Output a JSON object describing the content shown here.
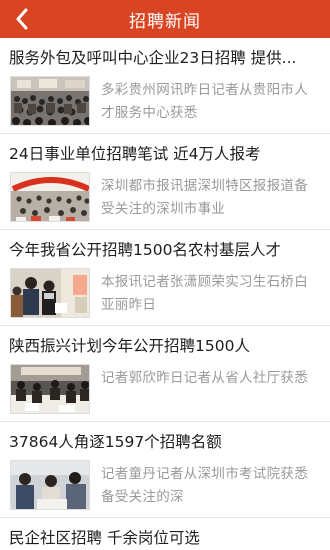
{
  "header": {
    "title": "招聘新闻",
    "background": "#d94423"
  },
  "news": [
    {
      "title": "服务外包及呼叫中心企业23日招聘 提供...",
      "summary": "多彩贵州网讯昨日记者从贵阳市人才服务中心获悉",
      "thumb": "crowd-hall-photo"
    },
    {
      "title": "24日事业单位招聘笔试 近4万人报考",
      "summary": "深圳都市报讯据深圳特区报报道备受关注的深圳市事业",
      "thumb": "exam-hall-photo"
    },
    {
      "title": "今年我省公开招聘1500名农村基层人才",
      "summary": "本报讯记者张潇顾荣实习生石桥白亚丽昨日",
      "thumb": "job-fair-photo"
    },
    {
      "title": "陕西振兴计划今年公开招聘1500人",
      "summary": "记者郭欣昨日记者从省人社厅获悉",
      "thumb": "recruitment-desk-photo"
    },
    {
      "title": "37864人角逐1597个招聘名额",
      "summary": "记者童丹记者从深圳市考试院获悉备受关注的深",
      "thumb": "interview-photo"
    },
    {
      "title": "民企社区招聘 千余岗位可选",
      "summary": "",
      "thumb": ""
    }
  ]
}
